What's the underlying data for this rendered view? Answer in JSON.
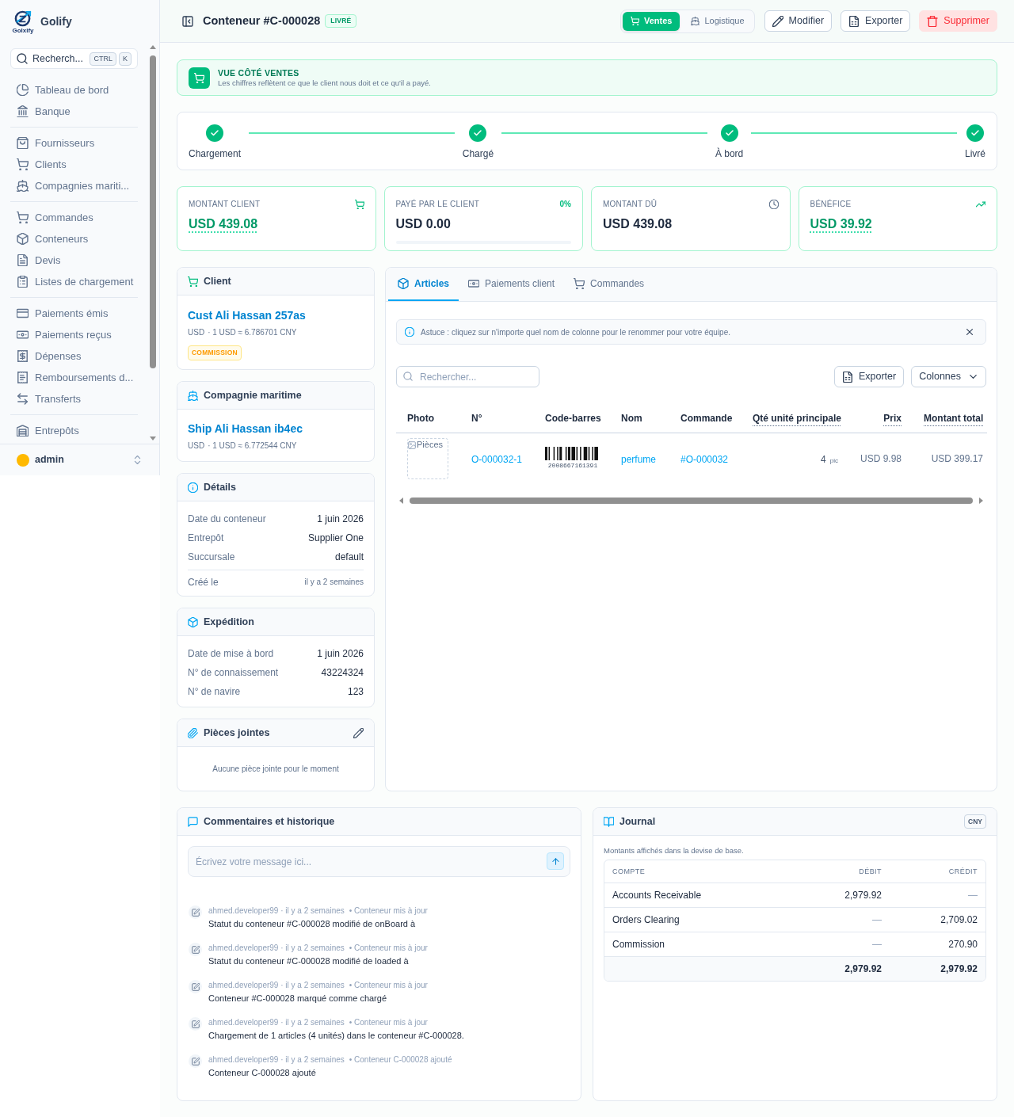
{
  "sidebar": {
    "brand": "Golify",
    "logo_caption": "Golxify",
    "search_label": "Recherch...",
    "shortcut": [
      "CTRL",
      "K"
    ],
    "groups": [
      [
        {
          "label": "Tableau de bord",
          "selected": false
        },
        {
          "label": "Banque",
          "selected": false
        }
      ],
      [
        {
          "label": "Fournisseurs",
          "selected": false
        },
        {
          "label": "Clients",
          "selected": false
        },
        {
          "label": "Compagnies mariti...",
          "selected": false
        }
      ],
      [
        {
          "label": "Commandes",
          "selected": false
        },
        {
          "label": "Conteneurs",
          "selected": false
        },
        {
          "label": "Devis",
          "selected": false
        },
        {
          "label": "Listes de chargement",
          "selected": false
        }
      ],
      [
        {
          "label": "Paiements émis",
          "selected": false
        },
        {
          "label": "Paiements reçus",
          "selected": false
        },
        {
          "label": "Dépenses",
          "selected": false
        },
        {
          "label": "Remboursements d...",
          "selected": false
        },
        {
          "label": "Transferts",
          "selected": false
        }
      ],
      [
        {
          "label": "Entrepôts",
          "selected": false
        }
      ]
    ],
    "user": {
      "name": "admin"
    }
  },
  "header": {
    "title": "Conteneur #C-000028",
    "status": "LIVRÉ",
    "views": [
      {
        "label": "Ventes",
        "selected": true
      },
      {
        "label": "Logistique",
        "selected": false
      }
    ],
    "actions": [
      {
        "label": "Modifier",
        "kind": "default"
      },
      {
        "label": "Exporter",
        "kind": "default"
      },
      {
        "label": "Supprimer",
        "kind": "danger"
      }
    ]
  },
  "banner": {
    "title": "VUE CÔTÉ VENTES",
    "text": "Les chiffres reflètent ce que le client nous doit et ce qu'il a payé."
  },
  "steps": [
    {
      "label": "Chargement",
      "done": true
    },
    {
      "label": "Chargé",
      "done": true
    },
    {
      "label": "À bord",
      "done": true
    },
    {
      "label": "Livré",
      "done": true
    }
  ],
  "stats": [
    {
      "label": "MONTANT CLIENT",
      "value": "USD 439.08",
      "highlight": true
    },
    {
      "label": "PAYÉ PAR LE CLIENT",
      "value": "USD 0.00",
      "highlight": false,
      "percent": "0%",
      "level": 0
    },
    {
      "label": "MONTANT DÛ",
      "value": "USD 439.08",
      "highlight": false
    },
    {
      "label": "BÉNÉFICE",
      "value": "USD 39.92",
      "highlight": true
    }
  ],
  "client": {
    "title": "Client",
    "name": "Cust Ali Hassan 257as",
    "currency": "USD",
    "rate": "· 1 USD ≈ 6.786701 CNY",
    "tag": "COMMISSION"
  },
  "shipping_company": {
    "title": "Compagnie maritime",
    "name": "Ship Ali Hassan ib4ec",
    "currency": "USD",
    "rate": "· 1 USD ≈ 6.772544 CNY"
  },
  "details": {
    "title": "Détails",
    "rows": [
      {
        "label": "Date du conteneur",
        "value": "1 juin 2026"
      },
      {
        "label": "Entrepôt",
        "value": "Supplier One"
      },
      {
        "label": "Succursale",
        "value": "default"
      }
    ],
    "created": {
      "label": "Créé le",
      "value": "il y a 2 semaines"
    }
  },
  "shipment": {
    "title": "Expédition",
    "rows": [
      {
        "label": "Date de mise à bord",
        "value": "1 juin 2026"
      },
      {
        "label": "N° de connaissement",
        "value": "43224324"
      },
      {
        "label": "N° de navire",
        "value": "123"
      }
    ]
  },
  "attachments": {
    "title": "Pièces jointes",
    "empty_text": "Aucune pièce jointe pour le moment"
  },
  "items_panel": {
    "tabs": [
      {
        "label": "Articles",
        "selected": true
      },
      {
        "label": "Paiements client",
        "selected": false
      },
      {
        "label": "Commandes",
        "selected": false
      }
    ],
    "tip": "Astuce : cliquez sur n'importe quel nom de colonne pour le renommer pour votre équipe.",
    "search": {
      "placeholder": "Rechercher..."
    },
    "buttons": [
      {
        "label": "Exporter"
      },
      {
        "label": "Colonnes"
      }
    ],
    "table": {
      "columns": [
        {
          "label": "Photo",
          "underlined": false
        },
        {
          "label": "N°",
          "underlined": false
        },
        {
          "label": "Code-barres",
          "underlined": false
        },
        {
          "label": "Nom",
          "underlined": false
        },
        {
          "label": "Commande",
          "underlined": false
        },
        {
          "label": "Qté unité principale",
          "underlined": true
        },
        {
          "label": "Prix",
          "underlined": true
        },
        {
          "label": "Montant total",
          "underlined": true
        }
      ],
      "rows": [
        {
          "photo_alt": "Pièces",
          "number": "O-000032-1",
          "barcode": "2008667161391",
          "name": "perfume",
          "order": "#O-000032",
          "quantity": "4",
          "unit": "pic",
          "price": "USD 9.98",
          "total": "USD 399.17"
        }
      ]
    }
  },
  "comments": {
    "title": "Commentaires et historique",
    "input": {
      "placeholder": "Écrivez votre message ici..."
    },
    "history": [
      {
        "meta": "ahmed.developer99 · il y a 2 semaines",
        "action": "• Conteneur mis à jour",
        "text": "Statut du conteneur #C-000028 modifié de onBoard à"
      },
      {
        "meta": "ahmed.developer99 · il y a 2 semaines",
        "action": "• Conteneur mis à jour",
        "text": "Statut du conteneur #C-000028 modifié de loaded à"
      },
      {
        "meta": "ahmed.developer99 · il y a 2 semaines",
        "action": "• Conteneur mis à jour",
        "text": "Conteneur #C-000028 marqué comme chargé"
      },
      {
        "meta": "ahmed.developer99 · il y a 2 semaines",
        "action": "• Conteneur mis à jour",
        "text": "Chargement de 1 articles (4 unités) dans le conteneur #C-000028."
      },
      {
        "meta": "ahmed.developer99 · il y a 2 semaines",
        "action": "• Conteneur C-000028 ajouté",
        "text": "Conteneur C-000028 ajouté"
      }
    ]
  },
  "journal": {
    "title": "Journal",
    "currency": "CNY",
    "note": "Montants affichés dans la devise de base.",
    "columns": [
      "COMPTE",
      "DÉBIT",
      "CRÉDIT"
    ],
    "rows": [
      {
        "account": "Accounts Receivable",
        "debit": {
          "text": "2,979.92",
          "muted": false
        },
        "credit": {
          "text": "—",
          "muted": true
        }
      },
      {
        "account": "Orders Clearing",
        "debit": {
          "text": "—",
          "muted": true
        },
        "credit": {
          "text": "2,709.02",
          "muted": false
        }
      },
      {
        "account": "Commission",
        "debit": {
          "text": "—",
          "muted": true
        },
        "credit": {
          "text": "270.90",
          "muted": false
        }
      }
    ],
    "totals": [
      "2,979.92",
      "2,979.92"
    ]
  }
}
